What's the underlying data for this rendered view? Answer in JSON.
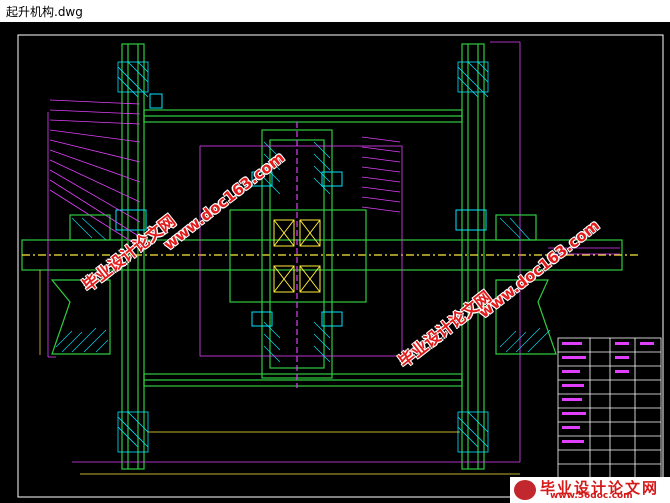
{
  "window": {
    "title": "起升机构.dwg"
  },
  "watermarks": {
    "site_url": "www.doc163.com",
    "site_name": "毕业设计论文网"
  },
  "footer_logo": {
    "name": "毕业设计论文网",
    "url": "www.56doc.com"
  },
  "colors": {
    "background": "#000000",
    "frame": "#ffffff",
    "structure_green": "#2ecc40",
    "axis_magenta": "#e040fb",
    "hatch_cyan": "#00e5ff",
    "bearing_yellow": "#ffeb3b",
    "watermark_red": "#e31b1b"
  }
}
